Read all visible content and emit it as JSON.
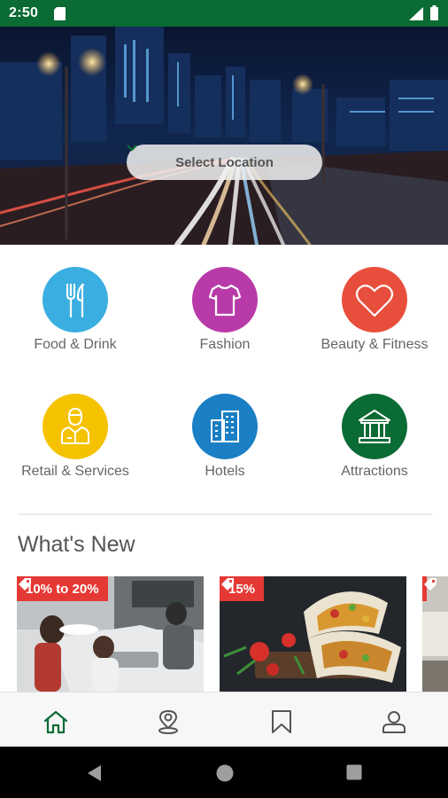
{
  "status_bar": {
    "time": "2:50",
    "icons": [
      "sd-card-icon",
      "signal-icon",
      "battery-icon"
    ]
  },
  "hero": {
    "image": "city-night-highway-photo",
    "location_button": {
      "label": "Select Location",
      "icon": "chevron-down-icon"
    }
  },
  "categories": [
    {
      "label": "Food & Drink",
      "icon": "fork-knife-icon",
      "color": "#3aaee0"
    },
    {
      "label": "Fashion",
      "icon": "tshirt-icon",
      "color": "#b83aa8"
    },
    {
      "label": "Beauty & Fitness",
      "icon": "heart-icon",
      "color": "#e84e3c"
    },
    {
      "label": "Retail & Services",
      "icon": "retail-person-icon",
      "color": "#f5c200"
    },
    {
      "label": "Hotels",
      "icon": "hotel-building-icon",
      "color": "#1a7fc4"
    },
    {
      "label": "Attractions",
      "icon": "museum-icon",
      "color": "#0a6b34"
    }
  ],
  "whats_new": {
    "title": "What's New",
    "deals": [
      {
        "badge": "10% to 20%",
        "image": "cafe-kitchen-photo"
      },
      {
        "badge": "15%",
        "image": "wraps-tomatoes-photo"
      },
      {
        "badge": "",
        "image": "partial-deal-photo"
      }
    ]
  },
  "bottom_nav": [
    {
      "name": "home",
      "icon": "home-icon",
      "active": true
    },
    {
      "name": "location",
      "icon": "map-pin-icon",
      "active": false
    },
    {
      "name": "saved",
      "icon": "bookmark-icon",
      "active": false
    },
    {
      "name": "profile",
      "icon": "user-icon",
      "active": false
    }
  ],
  "colors": {
    "primary": "#0a6b34",
    "badge": "#e53935",
    "text": "#666666"
  }
}
